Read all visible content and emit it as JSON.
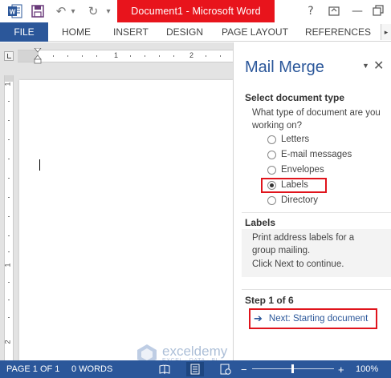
{
  "window": {
    "title": "Document1 -  Microsoft Word",
    "help": "?",
    "minimize": "—",
    "close": "✕"
  },
  "quick_access": {
    "undo": "↶",
    "redo": "↻",
    "dropdown": "▾"
  },
  "ribbon": {
    "file": "FILE",
    "tabs": [
      "HOME",
      "INSERT",
      "DESIGN",
      "PAGE LAYOUT",
      "REFERENCES"
    ],
    "more": "▸"
  },
  "ruler": {
    "h_numbers": [
      "1",
      "2"
    ],
    "v_numbers": [
      "1",
      "1",
      "2"
    ]
  },
  "pane": {
    "title": "Mail Merge",
    "menu": "▼",
    "close": "✕",
    "select_heading": "Select document type",
    "question": "What type of document are you working on?",
    "options": [
      "Letters",
      "E-mail messages",
      "Envelopes",
      "Labels",
      "Directory"
    ],
    "selected_option": "Labels",
    "labels_heading": "Labels",
    "labels_description": "Print address labels for a group mailing.",
    "continue_text": "Click Next to continue.",
    "step": "Step 1 of 6",
    "next_arrow": "➔",
    "next_link": "Next: Starting document"
  },
  "watermark": {
    "name": "exceldemy",
    "tagline": "EXCEL · DATA · BI"
  },
  "statusbar": {
    "page": "PAGE 1 OF 1",
    "words": "0 WORDS",
    "zoom_minus": "−",
    "zoom_plus": "+",
    "zoom": "100%",
    "zoom_level_percent": 100
  },
  "colors": {
    "accent": "#2b579a",
    "title_highlight": "#e8141c",
    "annotation_red": "#e0141c"
  }
}
